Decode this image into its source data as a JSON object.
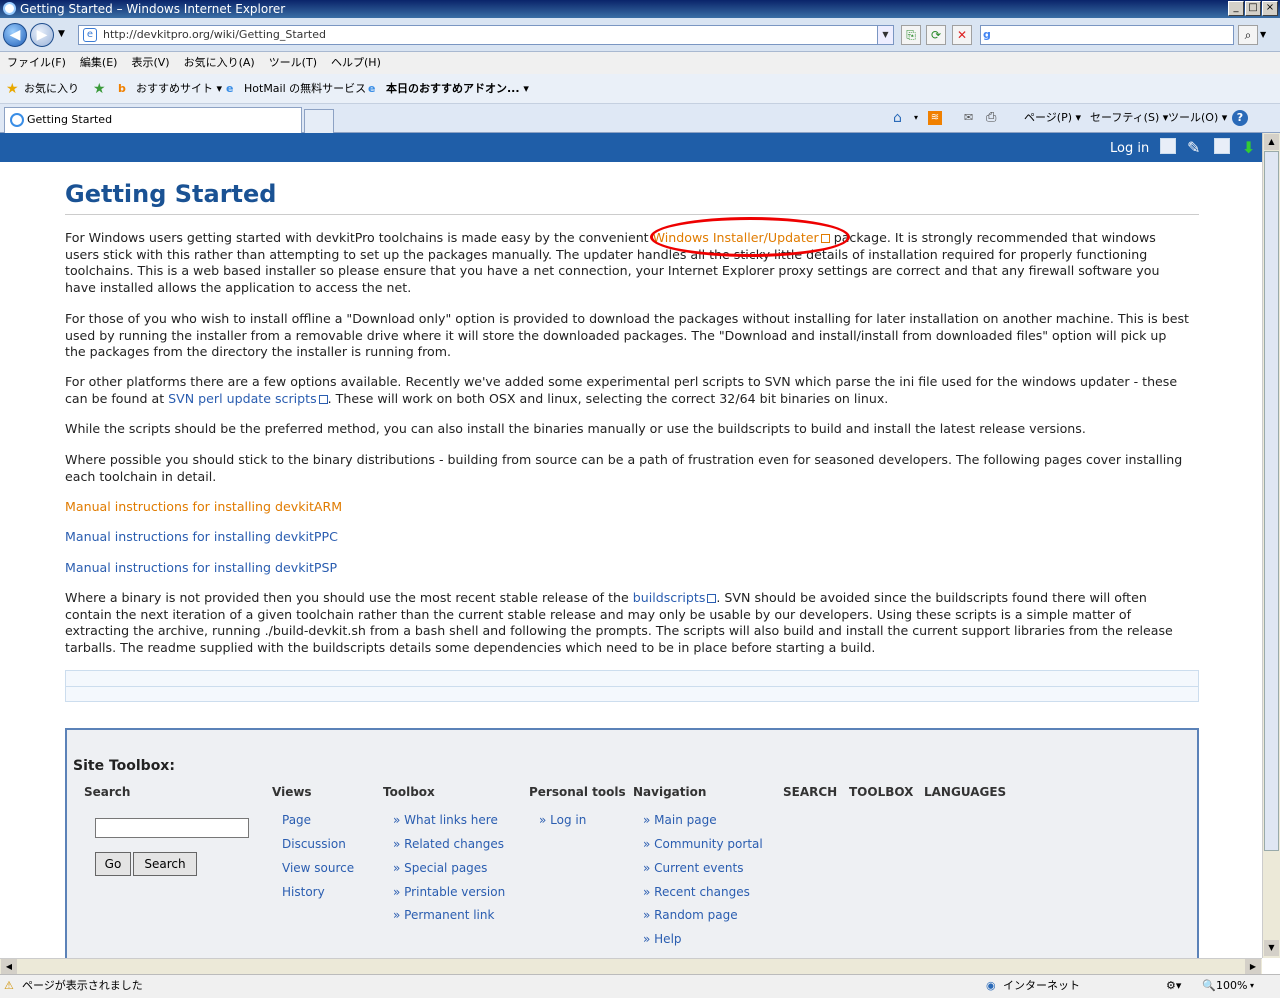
{
  "window": {
    "title": "Getting Started – Windows Internet Explorer"
  },
  "address": {
    "url": "http://devkitpro.org/wiki/Getting_Started"
  },
  "menu": [
    "ファイル(F)",
    "編集(E)",
    "表示(V)",
    "お気に入り(A)",
    "ツール(T)",
    "ヘルプ(H)"
  ],
  "favorites": {
    "star_label": "お気に入り",
    "items": [
      "おすすめサイト ▾",
      "HotMail の無料サービス",
      "本日のおすすめアドオン... ▾"
    ]
  },
  "tab": {
    "label": "Getting Started"
  },
  "commandbar": {
    "page": "ページ(P) ▾",
    "safety": "セーフティ(S) ▾",
    "tools": "ツール(O) ▾",
    "help": "?"
  },
  "wiki": {
    "login": "Log in",
    "title": "Getting Started",
    "p1_before": "For Windows users getting started with devkitPro toolchains is made easy by the convenient ",
    "p1_link": "Windows Installer/Updater",
    "p1_after": " package. It is strongly recommended that windows users stick with this rather than attempting to set up the packages manually. The updater handles all the sticky little details of installation required for properly functioning toolchains. This is a web based installer so please ensure that you have a net connection, your Internet Explorer proxy settings are correct and that any firewall software you have installed allows the application to access the net.",
    "p2": "For those of you who wish to install offline a \"Download only\" option is provided to download the packages without installing for later installation on another machine. This is best used by running the installer from a removable drive where it will store the downloaded packages. The \"Download and install/install from downloaded files\" option will pick up the packages from the directory the installer is running from.",
    "p3_before": "For other platforms there are a few options available. Recently we've added some experimental perl scripts to SVN which parse the ini file used for the windows updater - these can be found at ",
    "p3_link": "SVN perl update scripts",
    "p3_after": ". These will work on both OSX and linux, selecting the correct 32/64 bit binaries on linux.",
    "p4": "While the scripts should be the preferred method, you can also install the binaries manually or use the buildscripts to build and install the latest release versions.",
    "p5": "Where possible you should stick to the binary distributions - building from source can be a path of frustration even for seasoned developers. The following pages cover installing each toolchain in detail.",
    "link_arm": "Manual instructions for installing devkitARM",
    "link_ppc": "Manual instructions for installing devkitPPC",
    "link_psp": "Manual instructions for installing devkitPSP",
    "p6_before": "Where a binary is not provided then you should use the most recent stable release of the ",
    "p6_link": "buildscripts",
    "p6_after": ". SVN should be avoided since the buildscripts found there will often contain the next iteration of a given toolchain rather than the current stable release and may only be usable by our developers. Using these scripts is a simple matter of extracting the archive, running ./build-devkit.sh from a bash shell and following the prompts. The scripts will also build and install the current support libraries from the release tarballs. The readme supplied with the buildscripts details some dependencies which need to be in place before starting a build."
  },
  "toolbox": {
    "title": "Site Toolbox:",
    "search_head": "Search",
    "go": "Go",
    "search_btn": "Search",
    "views_head": "Views",
    "views": [
      "Page",
      "Discussion",
      "View source",
      "History"
    ],
    "toolbox_head": "Toolbox",
    "tools": [
      "» What links here",
      "» Related changes",
      "» Special pages",
      "» Printable version",
      "» Permanent link"
    ],
    "personal_head": "Personal tools",
    "personal": [
      "» Log in"
    ],
    "nav_head": "Navigation",
    "nav": [
      "» Main page",
      "» Community portal",
      "» Current events",
      "» Recent changes",
      "» Random page",
      "» Help"
    ],
    "extra": [
      "SEARCH",
      "TOOLBOX",
      "LANGUAGES"
    ]
  },
  "status": {
    "text": "ページが表示されました",
    "zone": "インターネット",
    "zoom": "100%"
  }
}
